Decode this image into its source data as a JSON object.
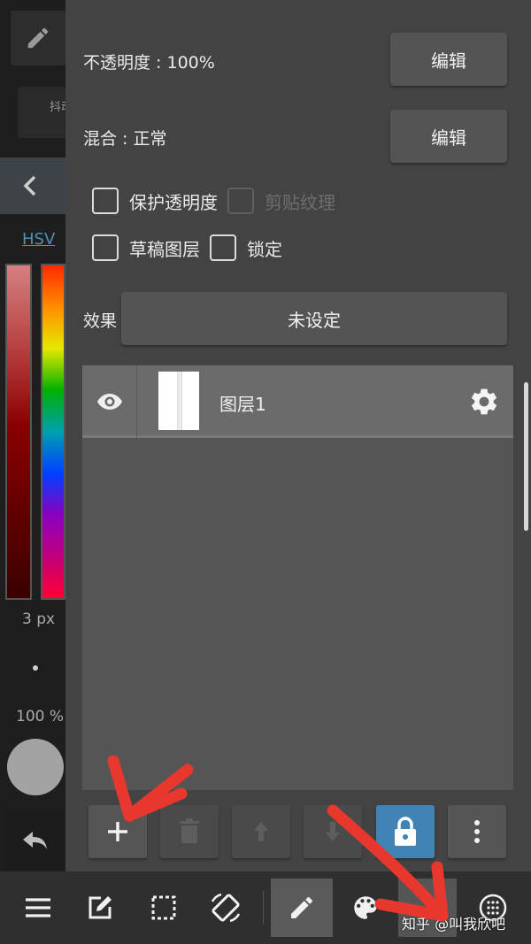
{
  "left_strip": {
    "brush_label": "抖动",
    "color_mode": "HSV",
    "brush_size": "3 px",
    "brush_opacity": "100 %"
  },
  "properties": {
    "opacity_label": "不透明度 : 100%",
    "opacity_edit": "编辑",
    "blend_label": "混合 : 正常",
    "blend_edit": "编辑",
    "protect_alpha": "保护透明度",
    "clipping": "剪贴纹理",
    "draft_layer": "草稿图层",
    "lock": "锁定",
    "effect_label": "效果",
    "effect_value": "未设定"
  },
  "layers": [
    {
      "name": "图层1"
    }
  ],
  "layer_toolbar": {
    "icons": [
      "add-layer-icon",
      "delete-icon",
      "move-up-icon",
      "move-down-icon",
      "lock-icon",
      "more-vert-icon"
    ]
  },
  "bottom_bar": {
    "icons": [
      "menu-icon",
      "edit-canvas-icon",
      "selection-icon",
      "rotate-icon",
      "pen-icon",
      "palette-icon",
      "grid-icon"
    ],
    "active": "pen-icon"
  },
  "watermark": "知乎 @叫我欣吧",
  "colors": {
    "panel_bg": "#434343",
    "button_bg": "#545454",
    "lock_active": "#3f84b5",
    "annotation_arrow": "#e8382e"
  }
}
